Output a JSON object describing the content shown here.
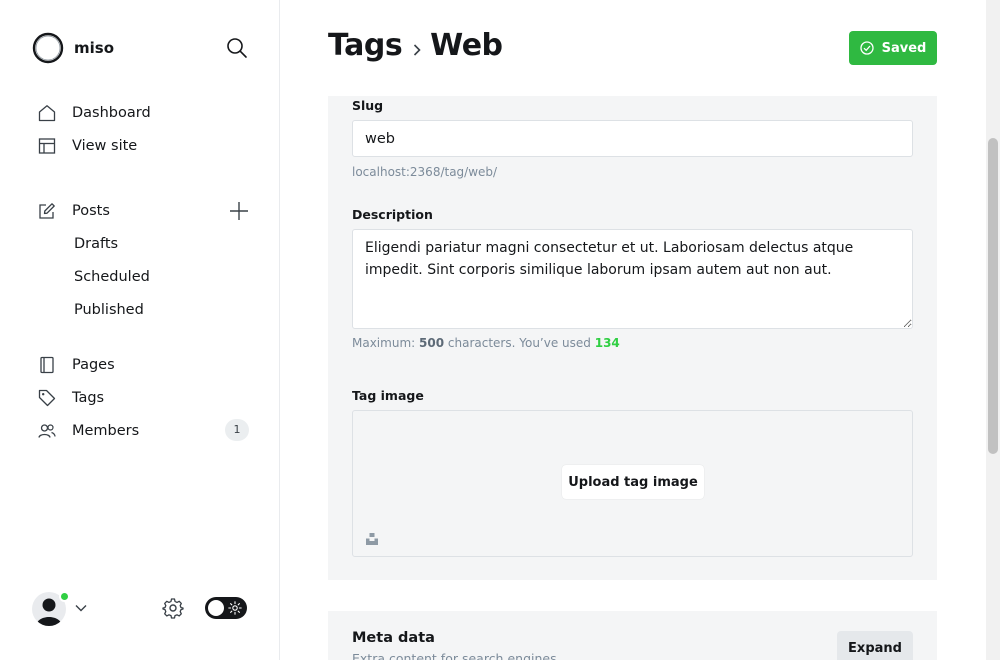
{
  "brand": {
    "name": "miso"
  },
  "sidebar": {
    "items": [
      {
        "label": "Dashboard",
        "icon": "home-icon"
      },
      {
        "label": "View site",
        "icon": "layout-icon"
      },
      {
        "label": "Posts",
        "icon": "edit-icon"
      },
      {
        "label": "Pages",
        "icon": "page-icon"
      },
      {
        "label": "Tags",
        "icon": "tag-icon"
      },
      {
        "label": "Members",
        "icon": "members-icon"
      }
    ],
    "post_subitems": [
      "Drafts",
      "Scheduled",
      "Published"
    ],
    "members_count": "1"
  },
  "header": {
    "breadcrumb_parent": "Tags",
    "breadcrumb_current": "Web",
    "saved_label": "Saved"
  },
  "form": {
    "slug_label": "Slug",
    "slug_value": "web",
    "slug_url": "localhost:2368/tag/web/",
    "description_label": "Description",
    "description_value": "Eligendi pariatur magni consectetur et ut. Laboriosam delectus atque impedit. Sint corporis similique laborum ipsam autem aut non aut.",
    "description_hint_prefix": "Maximum:",
    "description_max": "500",
    "description_hint_mid": "characters. You’ve used",
    "description_used": "134",
    "tag_image_label": "Tag image",
    "upload_label": "Upload tag image"
  },
  "meta": {
    "title": "Meta data",
    "subtitle": "Extra content for search engines",
    "expand_label": "Expand"
  },
  "colors": {
    "accent_green": "#30cf43",
    "panel_bg": "#f4f5f6",
    "text": "#15171a"
  }
}
